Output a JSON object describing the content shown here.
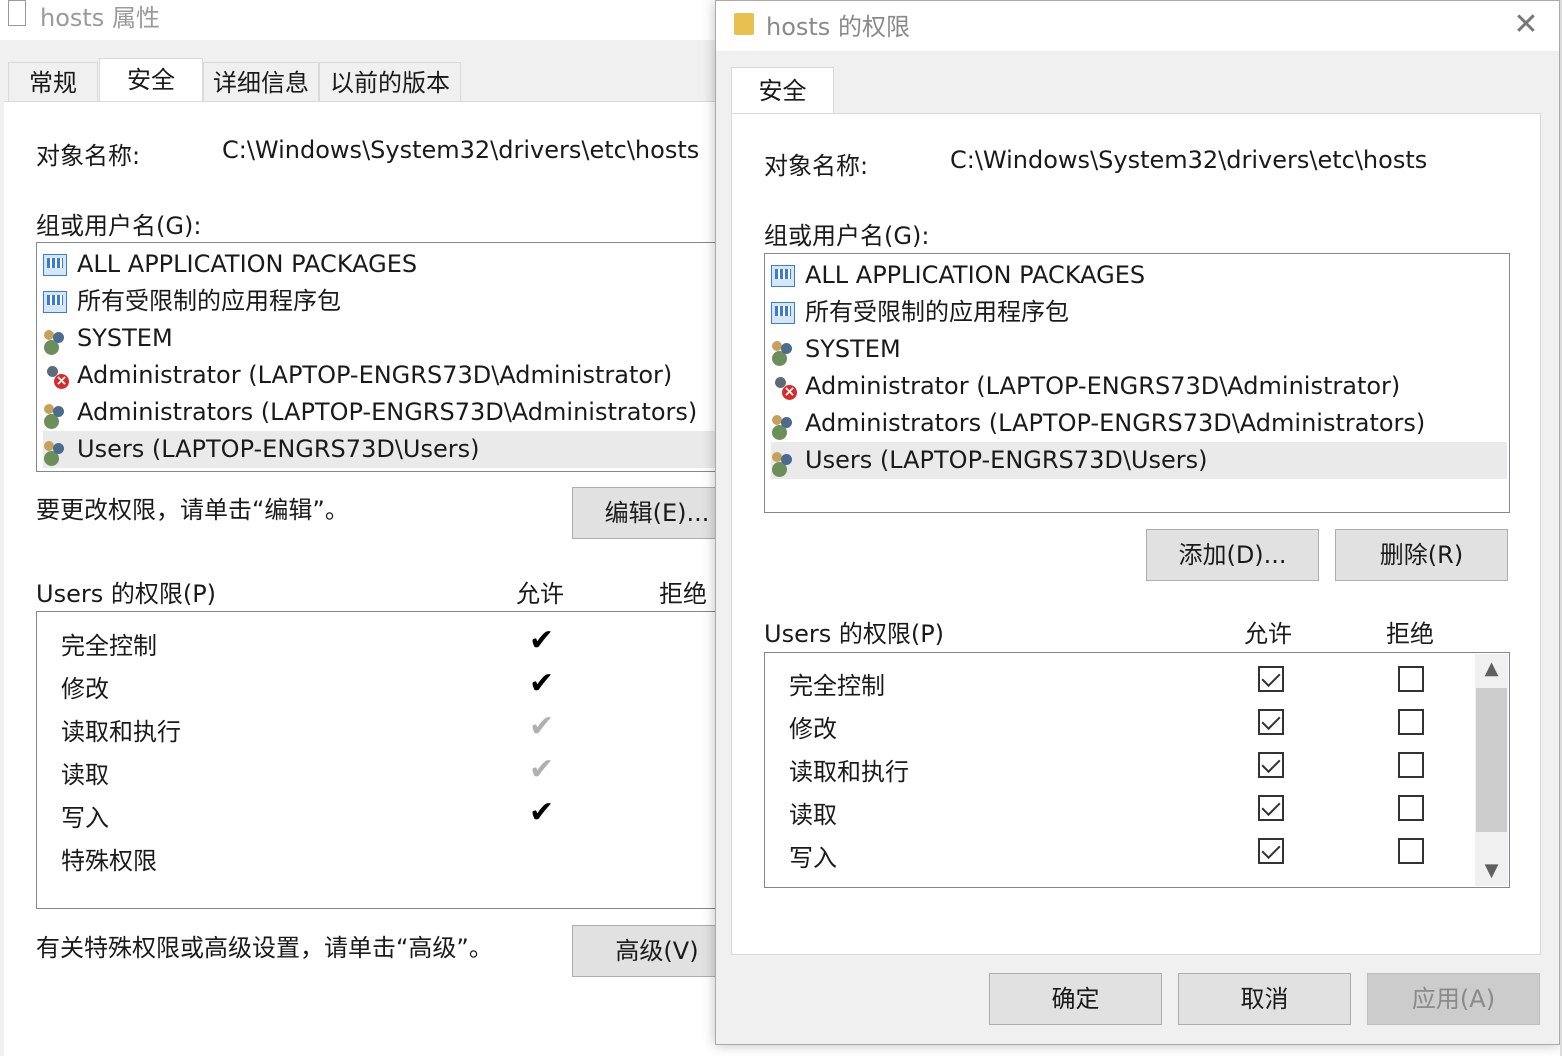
{
  "bg": {
    "title": "hosts 属性",
    "tabs": [
      "常规",
      "安全",
      "详细信息",
      "以前的版本"
    ],
    "object_label": "对象名称:",
    "object_value": "C:\\Windows\\System32\\drivers\\etc\\hosts",
    "group_label": "组或用户名(G):",
    "principals": [
      {
        "icon": "package-icon",
        "label": "ALL APPLICATION PACKAGES"
      },
      {
        "icon": "package-icon",
        "label": "所有受限制的应用程序包"
      },
      {
        "icon": "group-icon",
        "label": "SYSTEM"
      },
      {
        "icon": "user-denied-icon",
        "label": "Administrator (LAPTOP-ENGRS73D\\Administrator)"
      },
      {
        "icon": "group-icon",
        "label": "Administrators (LAPTOP-ENGRS73D\\Administrators)"
      },
      {
        "icon": "group-icon",
        "label": "Users (LAPTOP-ENGRS73D\\Users)",
        "selected": true
      }
    ],
    "edit_hint": "要更改权限，请单击“编辑”。",
    "edit_button": "编辑(E)...",
    "perm_title": "Users 的权限(P)",
    "allow_label": "允许",
    "deny_label": "拒绝",
    "permissions": [
      {
        "label": "完全控制",
        "allow": "checked"
      },
      {
        "label": "修改",
        "allow": "checked"
      },
      {
        "label": "读取和执行",
        "allow": "inherited"
      },
      {
        "label": "读取",
        "allow": "inherited"
      },
      {
        "label": "写入",
        "allow": "checked"
      },
      {
        "label": "特殊权限",
        "allow": "none"
      }
    ],
    "advanced_hint": "有关特殊权限或高级设置，请单击“高级”。",
    "advanced_button": "高级(V)"
  },
  "fg": {
    "title": "hosts 的权限",
    "close": "✕",
    "tab": "安全",
    "object_label": "对象名称:",
    "object_value": "C:\\Windows\\System32\\drivers\\etc\\hosts",
    "group_label": "组或用户名(G):",
    "principals": [
      {
        "icon": "package-icon",
        "label": "ALL APPLICATION PACKAGES"
      },
      {
        "icon": "package-icon",
        "label": "所有受限制的应用程序包"
      },
      {
        "icon": "group-icon",
        "label": "SYSTEM"
      },
      {
        "icon": "user-denied-icon",
        "label": "Administrator (LAPTOP-ENGRS73D\\Administrator)"
      },
      {
        "icon": "group-icon",
        "label": "Administrators (LAPTOP-ENGRS73D\\Administrators)"
      },
      {
        "icon": "group-icon",
        "label": "Users (LAPTOP-ENGRS73D\\Users)",
        "selected": true
      }
    ],
    "add_button": "添加(D)...",
    "remove_button": "删除(R)",
    "perm_title": "Users 的权限(P)",
    "allow_label": "允许",
    "deny_label": "拒绝",
    "permissions": [
      {
        "label": "完全控制",
        "allow": true,
        "deny": false
      },
      {
        "label": "修改",
        "allow": true,
        "deny": false
      },
      {
        "label": "读取和执行",
        "allow": true,
        "deny": false
      },
      {
        "label": "读取",
        "allow": true,
        "deny": false
      },
      {
        "label": "写入",
        "allow": true,
        "deny": false
      }
    ],
    "ok_button": "确定",
    "cancel_button": "取消",
    "apply_button": "应用(A)"
  }
}
